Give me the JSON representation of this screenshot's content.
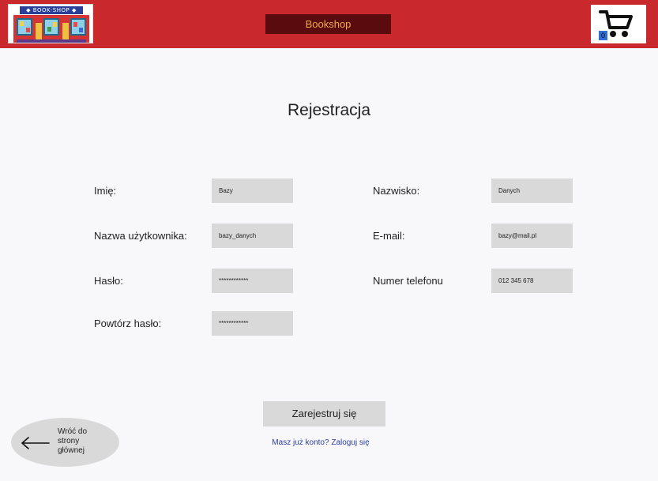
{
  "header": {
    "logo_text": "◆ BOOK·SHOP ◆",
    "brand": "Bookshop",
    "cart_count": "0"
  },
  "form": {
    "title": "Rejestracja",
    "fields": {
      "first_name": {
        "label": "Imię:",
        "value": "Bazy"
      },
      "last_name": {
        "label": "Nazwisko:",
        "value": "Danych"
      },
      "username": {
        "label": "Nazwa użytkownika:",
        "value": "bazy_danych"
      },
      "email": {
        "label": "E-mail:",
        "value": "bazy@mail.pl"
      },
      "password": {
        "label": "Hasło:",
        "value": "************"
      },
      "phone": {
        "label": "Numer telefonu",
        "value": "012 345 678"
      },
      "password_repeat": {
        "label": "Powtórz hasło:",
        "value": "************"
      }
    },
    "submit_label": "Zarejestruj się",
    "login_link": "Masz już konto? Zaloguj się"
  },
  "back": {
    "label_line1": "Wróć do",
    "label_line2": "strony",
    "label_line3": "głównej"
  },
  "colors": {
    "header_bg": "#c9292c",
    "brand_bg": "#5a0b0d",
    "brand_text": "#f0a94a",
    "input_bg": "#d9d9d9",
    "link": "#2a3fa0"
  }
}
